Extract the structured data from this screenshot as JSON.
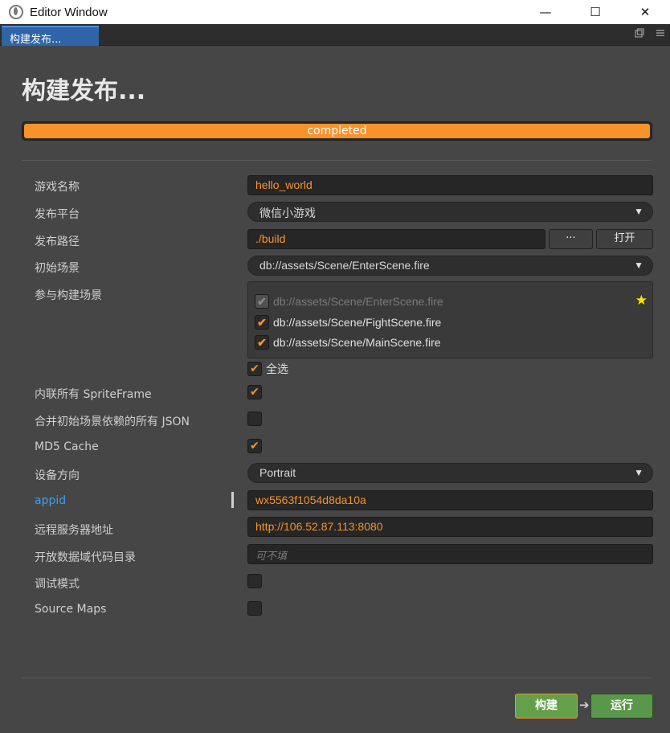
{
  "window": {
    "title": "Editor Window",
    "minimize": "—",
    "maximize": "☐",
    "close": "✕"
  },
  "tab": {
    "label": "构建发布..."
  },
  "page": {
    "heading": "构建发布..."
  },
  "progress": {
    "text": "completed",
    "percent": 100,
    "color": "#f7932b"
  },
  "form": {
    "game_name": {
      "label": "游戏名称",
      "value": "hello_world"
    },
    "platform": {
      "label": "发布平台",
      "value": "微信小游戏"
    },
    "path": {
      "label": "发布路径",
      "value": "./build",
      "browse": "···",
      "open": "打开"
    },
    "start_scene": {
      "label": "初始场景",
      "value": "db://assets/Scene/EnterScene.fire"
    },
    "scenes": {
      "label": "参与构建场景",
      "items": [
        {
          "text": "db://assets/Scene/EnterScene.fire",
          "checked": true,
          "disabled": true
        },
        {
          "text": "db://assets/Scene/FightScene.fire",
          "checked": true,
          "disabled": false
        },
        {
          "text": "db://assets/Scene/MainScene.fire",
          "checked": true,
          "disabled": false
        }
      ],
      "select_all": "全选"
    },
    "inline_sprite": {
      "label": "内联所有 SpriteFrame",
      "checked": true
    },
    "merge_json": {
      "label": "合并初始场景依赖的所有 JSON",
      "checked": false
    },
    "md5": {
      "label": "MD5 Cache",
      "checked": true
    },
    "orientation": {
      "label": "设备方向",
      "value": "Portrait"
    },
    "appid": {
      "label": "appid",
      "value": "wx5563f1054d8da10a"
    },
    "remote_server": {
      "label": "远程服务器地址",
      "value": "http://106.52.87.113:8080"
    },
    "open_data": {
      "label": "开放数据域代码目录",
      "placeholder": "可不填"
    },
    "debug": {
      "label": "调试模式",
      "checked": false
    },
    "source_maps": {
      "label": "Source Maps",
      "checked": false
    }
  },
  "footer": {
    "build": "构建",
    "run": "运行"
  },
  "colors": {
    "accent": "#f7932b",
    "link": "#3d9df2",
    "button_green": "#64a04a"
  }
}
